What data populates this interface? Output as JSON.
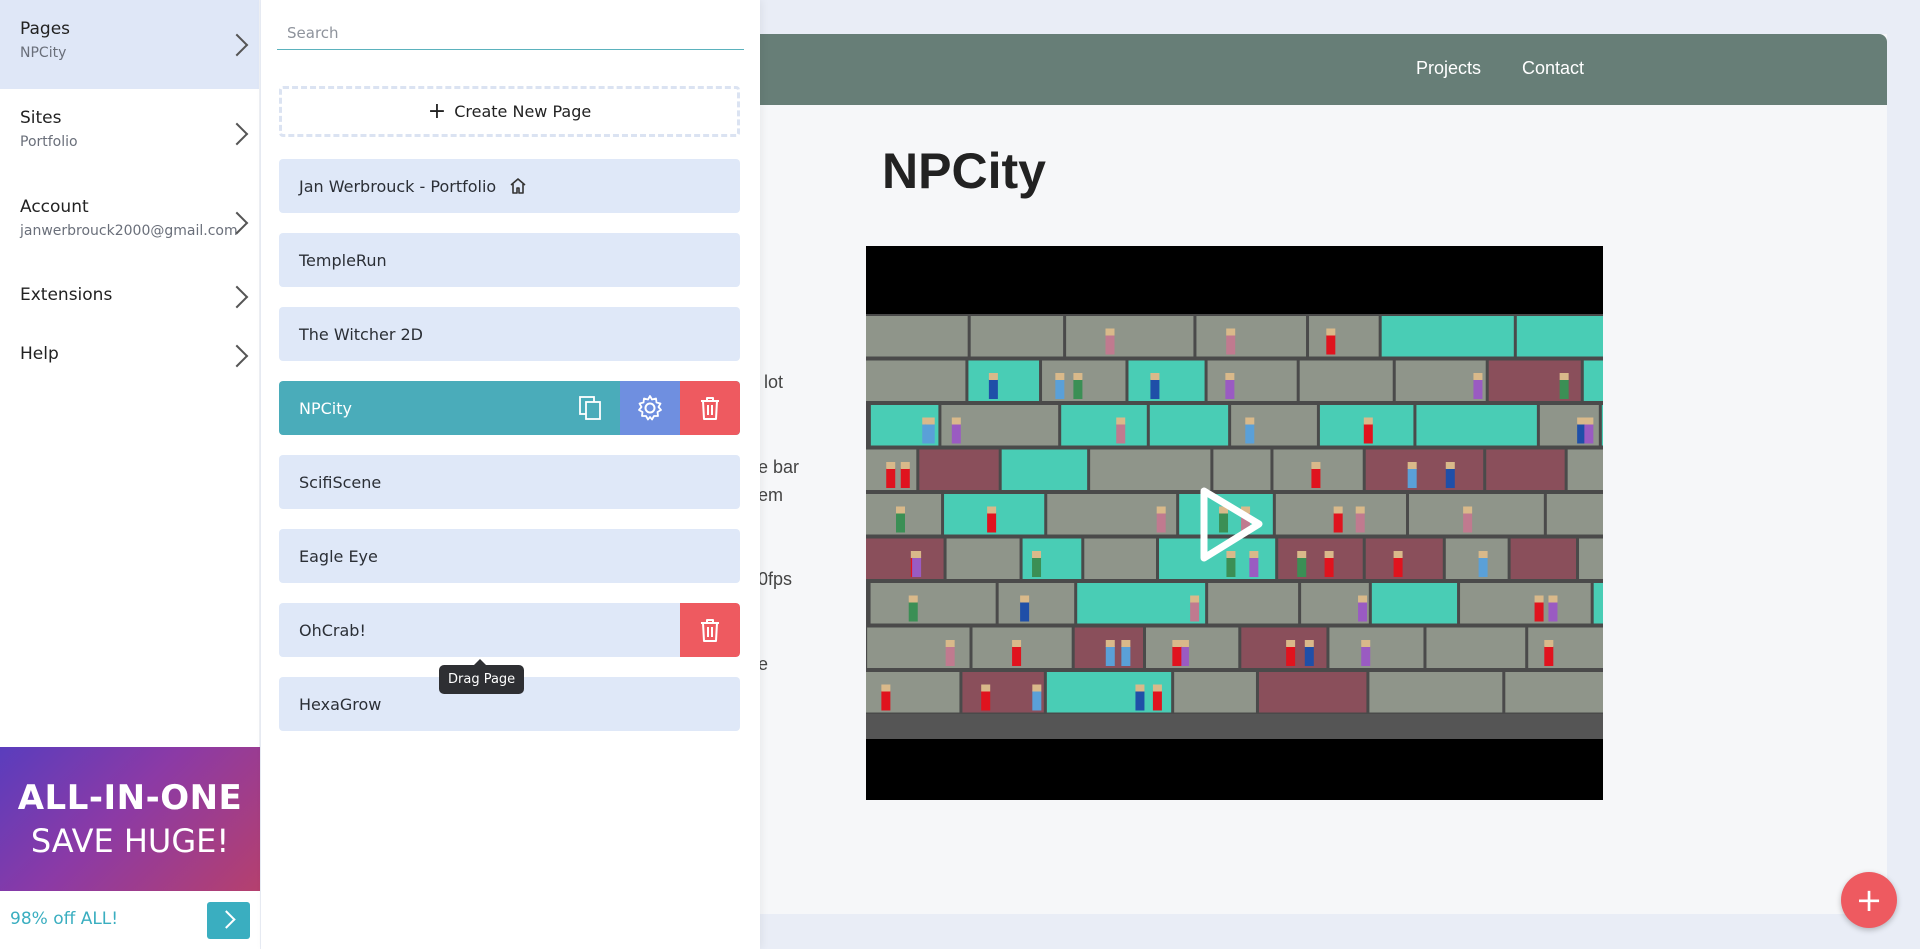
{
  "nav": {
    "items": [
      {
        "title": "Pages",
        "sub": "NPCity"
      },
      {
        "title": "Sites",
        "sub": "Portfolio"
      },
      {
        "title": "Account",
        "sub": "janwerbrouck2000@gmail.com"
      },
      {
        "title": "Extensions"
      },
      {
        "title": "Help"
      }
    ]
  },
  "promo": {
    "line1": "ALL-IN-ONE",
    "line2": "SAVE HUGE!",
    "bar_text": "98% off ALL!"
  },
  "pages_panel": {
    "search_placeholder": "Search",
    "create_label": "Create New Page",
    "pages": [
      {
        "label": "Jan Werbrouck - Portfolio",
        "home": true
      },
      {
        "label": "TempleRun"
      },
      {
        "label": "The Witcher 2D"
      },
      {
        "label": "NPCity",
        "active": true
      },
      {
        "label": "ScifiScene"
      },
      {
        "label": "Eagle Eye"
      },
      {
        "label": "OhCrab!"
      },
      {
        "label": "HexaGrow"
      }
    ],
    "tooltip": "Drag Page"
  },
  "site": {
    "nav": [
      "Projects",
      "Contact"
    ],
    "title": "NPCity",
    "cut_text": [
      "lot",
      "e bar",
      "em",
      "0fps",
      "e"
    ]
  },
  "colors": {
    "accent": "#4aacba",
    "header": "#677e77",
    "danger": "#ee5a60",
    "gear": "#6f8fe0",
    "row": "#dfe8f8"
  }
}
